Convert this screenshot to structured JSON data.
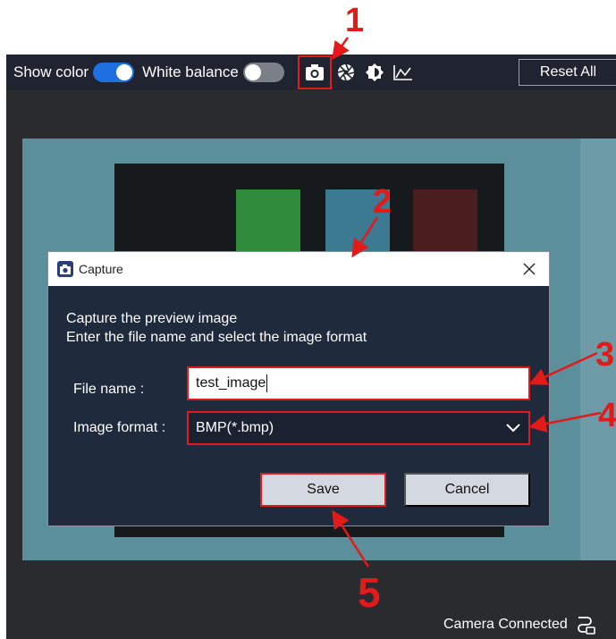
{
  "toolbar": {
    "show_color_label": "Show color",
    "show_color_on": true,
    "white_balance_label": "White balance",
    "white_balance_on": false,
    "icons": [
      "camera-icon",
      "aperture-icon",
      "brightness-icon",
      "graph-icon"
    ],
    "reset_label": "Reset All"
  },
  "dialog": {
    "title": "Capture",
    "line1": "Capture the preview image",
    "line2": "Enter the file name and select the image format",
    "file_label": "File name :",
    "file_value": "test_image",
    "format_label": "Image format :",
    "format_value": "BMP(*.bmp)",
    "save_label": "Save",
    "cancel_label": "Cancel"
  },
  "status": {
    "text": "Camera Connected"
  },
  "annotations": {
    "n1": "1",
    "n2": "2",
    "n3": "3",
    "n4": "4",
    "n5": "5",
    "color": "#e11a1a"
  },
  "colors": {
    "toolbar_bg": "#1f2430",
    "dialog_bg": "#1f2a3d",
    "toggle_on": "#1e6fe0"
  }
}
